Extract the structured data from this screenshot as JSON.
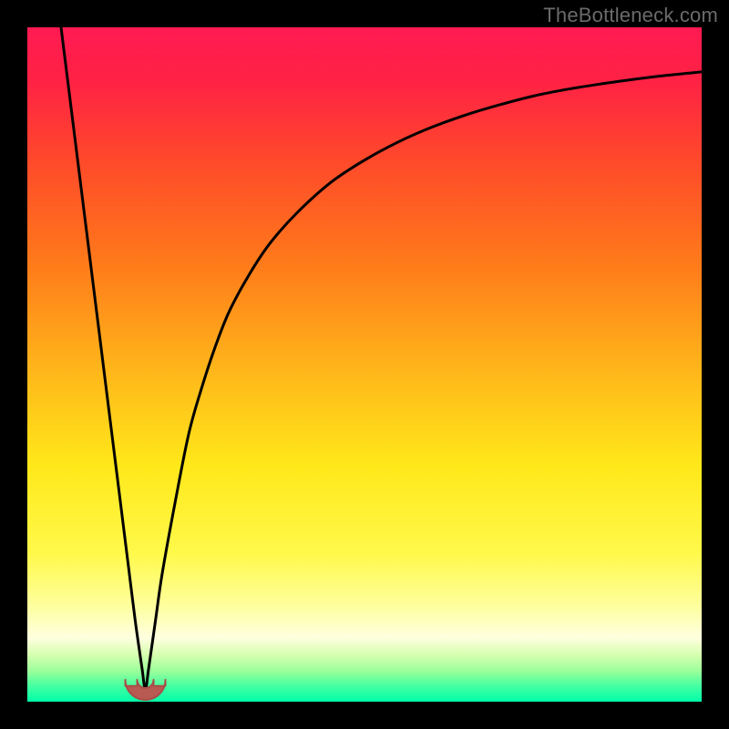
{
  "watermark": {
    "text": "TheBottleneck.com"
  },
  "colors": {
    "frame": "#000000",
    "gradient_stops": [
      {
        "offset": 0.0,
        "color": "#ff1a52"
      },
      {
        "offset": 0.08,
        "color": "#ff2244"
      },
      {
        "offset": 0.2,
        "color": "#ff4a2a"
      },
      {
        "offset": 0.35,
        "color": "#ff7a1a"
      },
      {
        "offset": 0.5,
        "color": "#ffb31a"
      },
      {
        "offset": 0.65,
        "color": "#ffe81a"
      },
      {
        "offset": 0.78,
        "color": "#fff94a"
      },
      {
        "offset": 0.86,
        "color": "#feffa0"
      },
      {
        "offset": 0.905,
        "color": "#ffffe0"
      },
      {
        "offset": 0.93,
        "color": "#d7ffb0"
      },
      {
        "offset": 0.955,
        "color": "#9aff9a"
      },
      {
        "offset": 0.975,
        "color": "#4affa0"
      },
      {
        "offset": 1.0,
        "color": "#00ffaa"
      }
    ],
    "curve": "#000000",
    "marker_fill": "#b85a52",
    "marker_stroke": "#a94d48"
  },
  "chart_data": {
    "type": "line",
    "title": "",
    "xlabel": "",
    "ylabel": "",
    "xlim": [
      0,
      100
    ],
    "ylim": [
      0,
      100
    ],
    "optimum_x": 17.5,
    "series": [
      {
        "name": "bottleneck-curve",
        "x": [
          5,
          6,
          7,
          8,
          9,
          10,
          11,
          12,
          13,
          14,
          15,
          16,
          17,
          17.5,
          18,
          19,
          20,
          22,
          24,
          26,
          28,
          30,
          33,
          36,
          40,
          45,
          50,
          55,
          60,
          65,
          70,
          75,
          80,
          85,
          90,
          95,
          100
        ],
        "y": [
          100,
          92,
          84,
          76,
          68,
          60,
          52,
          44,
          36,
          28,
          20,
          12,
          5,
          1.8,
          5,
          12,
          19,
          30,
          40,
          47,
          53,
          58,
          63.5,
          68,
          72.5,
          77,
          80.3,
          83,
          85.2,
          87,
          88.5,
          89.8,
          90.8,
          91.6,
          92.3,
          92.9,
          93.4
        ]
      }
    ],
    "marker": {
      "x": 17.5,
      "y": 1.8,
      "shape": "u",
      "label": ""
    }
  }
}
